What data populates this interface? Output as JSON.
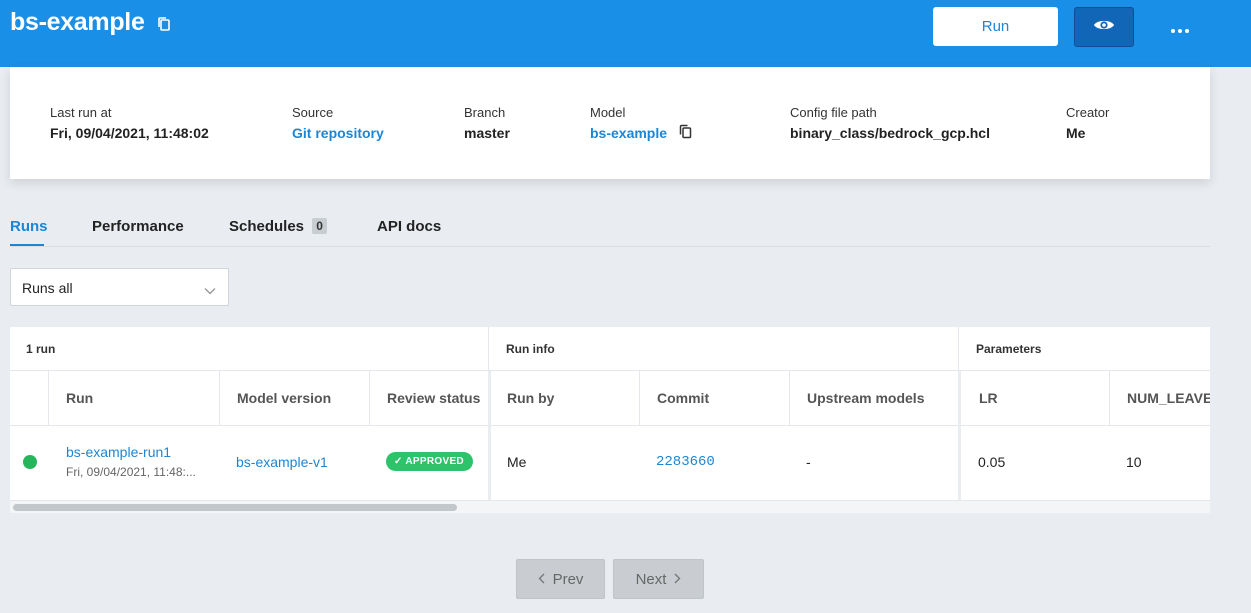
{
  "header": {
    "title": "bs-example",
    "run_label": "Run",
    "copy_icon": "copy-icon",
    "view_icon": "eye-icon",
    "more_icon": "more-horizontal-icon",
    "background": "#1a8fe8"
  },
  "info": {
    "last_run_label": "Last run at",
    "last_run_value": "Fri, 09/04/2021, 11:48:02",
    "source_label": "Source",
    "source_value": "Git repository",
    "branch_label": "Branch",
    "branch_value": "master",
    "model_label": "Model",
    "model_value": "bs-example",
    "config_label": "Config file path",
    "config_value": "binary_class/bedrock_gcp.hcl",
    "creator_label": "Creator",
    "creator_value": "Me"
  },
  "tabs": {
    "runs": "Runs",
    "performance": "Performance",
    "schedules": "Schedules",
    "schedules_count": "0",
    "api_docs": "API docs"
  },
  "filter": {
    "selected": "Runs all"
  },
  "table": {
    "groups": {
      "runs": "1 run",
      "run_info": "Run info",
      "parameters": "Parameters"
    },
    "columns": {
      "run": "Run",
      "model_version": "Model version",
      "review_status": "Review status",
      "run_by": "Run by",
      "commit": "Commit",
      "upstream": "Upstream models",
      "lr": "LR",
      "num_leaves": "NUM_LEAVES"
    },
    "rows": [
      {
        "run": "bs-example-run1",
        "run_time": "Fri, 09/04/2021, 11:48:...",
        "model_version": "bs-example-v1",
        "review_status": "APPROVED",
        "run_by": "Me",
        "commit": "2283660",
        "upstream": "-",
        "lr": "0.05",
        "num_leaves": "10"
      }
    ]
  },
  "pagination": {
    "prev": "Prev",
    "next": "Next"
  }
}
